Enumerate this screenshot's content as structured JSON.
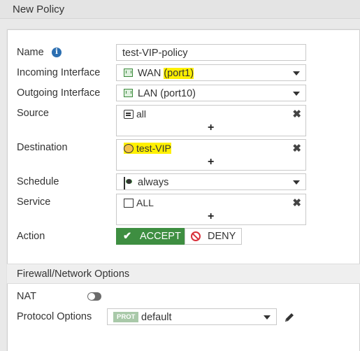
{
  "window": {
    "title": "New Policy"
  },
  "form": {
    "name": {
      "label": "Name",
      "value": "test-VIP-policy"
    },
    "incoming": {
      "label": "Incoming Interface",
      "value_prefix": "WAN ",
      "value_highlight": "(port1)"
    },
    "outgoing": {
      "label": "Outgoing Interface",
      "value": "LAN (port10)"
    },
    "source": {
      "label": "Source",
      "value": "all",
      "add": "+"
    },
    "destination": {
      "label": "Destination",
      "value": "test-VIP",
      "add": "+"
    },
    "schedule": {
      "label": "Schedule",
      "value": "always"
    },
    "service": {
      "label": "Service",
      "value": "ALL",
      "add": "+"
    },
    "action": {
      "label": "Action",
      "accept": "ACCEPT",
      "deny": "DENY",
      "selected": "ACCEPT"
    }
  },
  "firewall_options": {
    "heading": "Firewall/Network Options",
    "nat": {
      "label": "NAT",
      "enabled": false
    },
    "protocol": {
      "label": "Protocol Options",
      "badge": "PROT",
      "value": "default"
    }
  },
  "colors": {
    "accept": "#3e8e41",
    "highlight": "#fff000",
    "info": "#2c6fb1",
    "deny": "#d9303a"
  },
  "icons": {
    "name_info": "info-icon",
    "interface": "interface-icon",
    "address": "address-icon",
    "vip": "vip-icon",
    "schedule": "schedule-icon",
    "service": "service-icon",
    "remove": "close-icon",
    "edit": "pencil-icon"
  }
}
